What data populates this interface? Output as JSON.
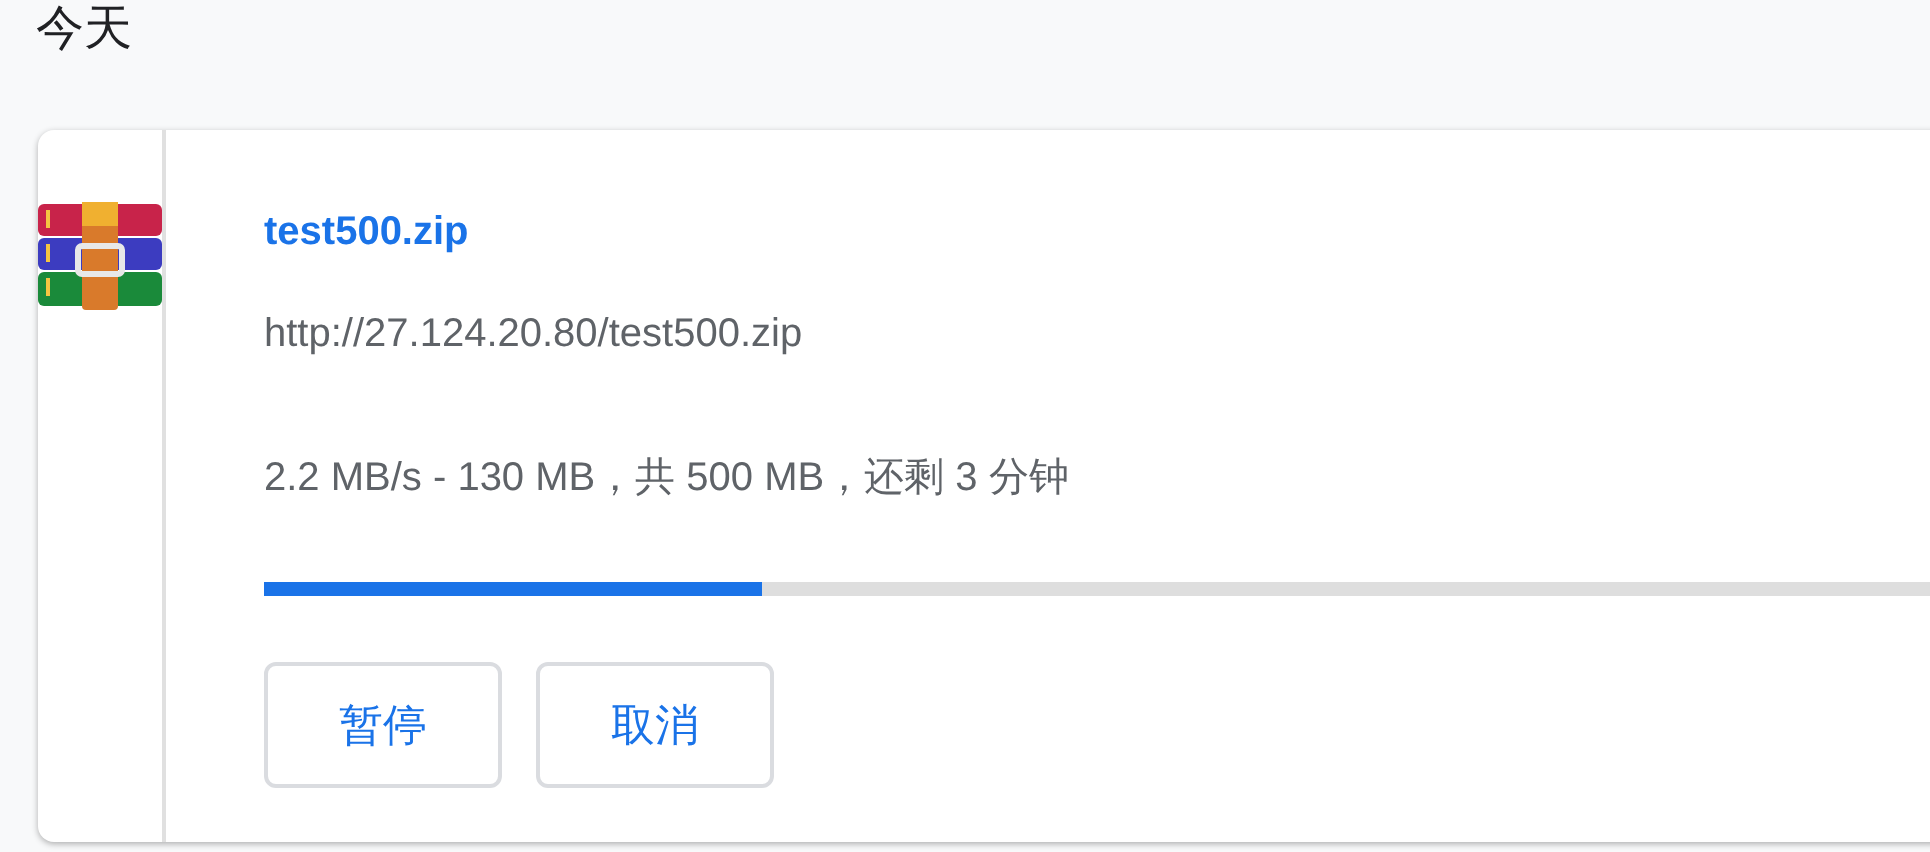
{
  "section_title": "今天",
  "download": {
    "file_name": "test500.zip",
    "url": "http://27.124.20.80/test500.zip",
    "status": "2.2 MB/s - 130 MB，共 500 MB，还剩 3 分钟",
    "level": 0.26,
    "buttons": [
      "暂停",
      "取消"
    ]
  }
}
